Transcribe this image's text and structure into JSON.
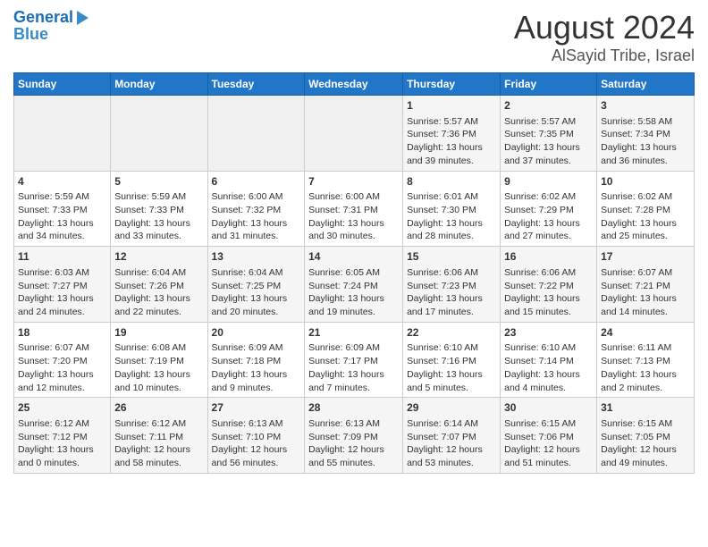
{
  "header": {
    "logo_line1": "General",
    "logo_line2": "Blue",
    "title": "August 2024",
    "subtitle": "AlSayid Tribe, Israel"
  },
  "weekdays": [
    "Sunday",
    "Monday",
    "Tuesday",
    "Wednesday",
    "Thursday",
    "Friday",
    "Saturday"
  ],
  "weeks": [
    [
      {
        "day": "",
        "content": ""
      },
      {
        "day": "",
        "content": ""
      },
      {
        "day": "",
        "content": ""
      },
      {
        "day": "",
        "content": ""
      },
      {
        "day": "1",
        "content": "Sunrise: 5:57 AM\nSunset: 7:36 PM\nDaylight: 13 hours and 39 minutes."
      },
      {
        "day": "2",
        "content": "Sunrise: 5:57 AM\nSunset: 7:35 PM\nDaylight: 13 hours and 37 minutes."
      },
      {
        "day": "3",
        "content": "Sunrise: 5:58 AM\nSunset: 7:34 PM\nDaylight: 13 hours and 36 minutes."
      }
    ],
    [
      {
        "day": "4",
        "content": "Sunrise: 5:59 AM\nSunset: 7:33 PM\nDaylight: 13 hours and 34 minutes."
      },
      {
        "day": "5",
        "content": "Sunrise: 5:59 AM\nSunset: 7:33 PM\nDaylight: 13 hours and 33 minutes."
      },
      {
        "day": "6",
        "content": "Sunrise: 6:00 AM\nSunset: 7:32 PM\nDaylight: 13 hours and 31 minutes."
      },
      {
        "day": "7",
        "content": "Sunrise: 6:00 AM\nSunset: 7:31 PM\nDaylight: 13 hours and 30 minutes."
      },
      {
        "day": "8",
        "content": "Sunrise: 6:01 AM\nSunset: 7:30 PM\nDaylight: 13 hours and 28 minutes."
      },
      {
        "day": "9",
        "content": "Sunrise: 6:02 AM\nSunset: 7:29 PM\nDaylight: 13 hours and 27 minutes."
      },
      {
        "day": "10",
        "content": "Sunrise: 6:02 AM\nSunset: 7:28 PM\nDaylight: 13 hours and 25 minutes."
      }
    ],
    [
      {
        "day": "11",
        "content": "Sunrise: 6:03 AM\nSunset: 7:27 PM\nDaylight: 13 hours and 24 minutes."
      },
      {
        "day": "12",
        "content": "Sunrise: 6:04 AM\nSunset: 7:26 PM\nDaylight: 13 hours and 22 minutes."
      },
      {
        "day": "13",
        "content": "Sunrise: 6:04 AM\nSunset: 7:25 PM\nDaylight: 13 hours and 20 minutes."
      },
      {
        "day": "14",
        "content": "Sunrise: 6:05 AM\nSunset: 7:24 PM\nDaylight: 13 hours and 19 minutes."
      },
      {
        "day": "15",
        "content": "Sunrise: 6:06 AM\nSunset: 7:23 PM\nDaylight: 13 hours and 17 minutes."
      },
      {
        "day": "16",
        "content": "Sunrise: 6:06 AM\nSunset: 7:22 PM\nDaylight: 13 hours and 15 minutes."
      },
      {
        "day": "17",
        "content": "Sunrise: 6:07 AM\nSunset: 7:21 PM\nDaylight: 13 hours and 14 minutes."
      }
    ],
    [
      {
        "day": "18",
        "content": "Sunrise: 6:07 AM\nSunset: 7:20 PM\nDaylight: 13 hours and 12 minutes."
      },
      {
        "day": "19",
        "content": "Sunrise: 6:08 AM\nSunset: 7:19 PM\nDaylight: 13 hours and 10 minutes."
      },
      {
        "day": "20",
        "content": "Sunrise: 6:09 AM\nSunset: 7:18 PM\nDaylight: 13 hours and 9 minutes."
      },
      {
        "day": "21",
        "content": "Sunrise: 6:09 AM\nSunset: 7:17 PM\nDaylight: 13 hours and 7 minutes."
      },
      {
        "day": "22",
        "content": "Sunrise: 6:10 AM\nSunset: 7:16 PM\nDaylight: 13 hours and 5 minutes."
      },
      {
        "day": "23",
        "content": "Sunrise: 6:10 AM\nSunset: 7:14 PM\nDaylight: 13 hours and 4 minutes."
      },
      {
        "day": "24",
        "content": "Sunrise: 6:11 AM\nSunset: 7:13 PM\nDaylight: 13 hours and 2 minutes."
      }
    ],
    [
      {
        "day": "25",
        "content": "Sunrise: 6:12 AM\nSunset: 7:12 PM\nDaylight: 13 hours and 0 minutes."
      },
      {
        "day": "26",
        "content": "Sunrise: 6:12 AM\nSunset: 7:11 PM\nDaylight: 12 hours and 58 minutes."
      },
      {
        "day": "27",
        "content": "Sunrise: 6:13 AM\nSunset: 7:10 PM\nDaylight: 12 hours and 56 minutes."
      },
      {
        "day": "28",
        "content": "Sunrise: 6:13 AM\nSunset: 7:09 PM\nDaylight: 12 hours and 55 minutes."
      },
      {
        "day": "29",
        "content": "Sunrise: 6:14 AM\nSunset: 7:07 PM\nDaylight: 12 hours and 53 minutes."
      },
      {
        "day": "30",
        "content": "Sunrise: 6:15 AM\nSunset: 7:06 PM\nDaylight: 12 hours and 51 minutes."
      },
      {
        "day": "31",
        "content": "Sunrise: 6:15 AM\nSunset: 7:05 PM\nDaylight: 12 hours and 49 minutes."
      }
    ]
  ]
}
